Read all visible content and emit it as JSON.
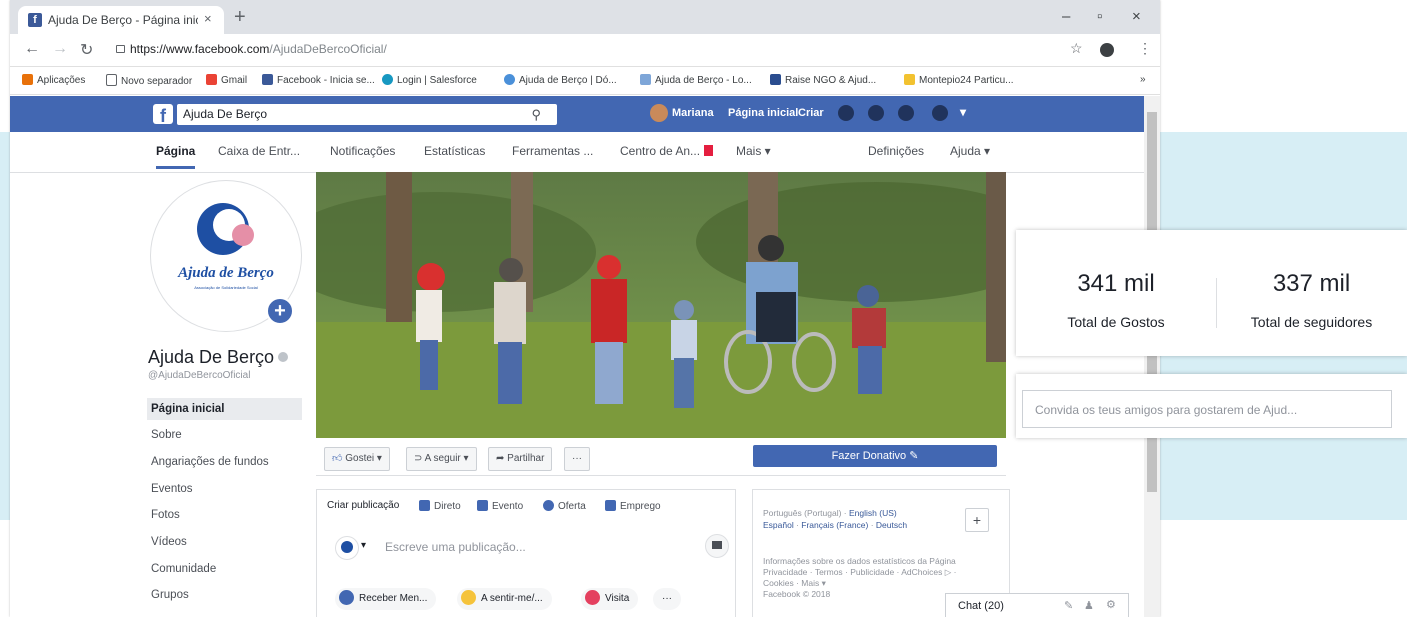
{
  "browser": {
    "tab_title": "Ajuda De Berço - Página inicial",
    "tab_close": "×",
    "new_tab": "+",
    "window_buttons": [
      "–",
      "▫",
      "×"
    ],
    "url_host": "https://www.facebook.com",
    "url_path": "/AjudaDeBercoOficial/",
    "bookmarks": [
      {
        "label": "Aplicações",
        "color": "#e8710a"
      },
      {
        "label": "Novo separador",
        "color": "#5f6368"
      },
      {
        "label": "Gmail",
        "color": "#ea4335"
      },
      {
        "label": "Facebook - Inicia se...",
        "color": "#3b5998"
      },
      {
        "label": "Login | Salesforce",
        "color": "#1798c1"
      },
      {
        "label": "Ajuda de Berço | Dó...",
        "color": "#4a90d9"
      },
      {
        "label": "Ajuda de Berço - Lo...",
        "color": "#7ea6d8"
      },
      {
        "label": "Raise NGO & Ajud...",
        "color": "#2a4d8f"
      },
      {
        "label": "Montepio24 Particu...",
        "color": "#f2c230"
      }
    ]
  },
  "fb": {
    "logo": "f",
    "search_value": "Ajuda De Berço",
    "user": "Mariana",
    "home": "Página inicial",
    "create": "Criar"
  },
  "pagenav": {
    "items": [
      "Página",
      "Caixa de Entr...",
      "Notificações",
      "Estatísticas",
      "Ferramentas ...",
      "Centro de An...",
      "Mais ▾",
      "Definições",
      "Ajuda ▾"
    ]
  },
  "page": {
    "logo_text": "Ajuda de Berço",
    "logo_sub": "Associação de Solidariedade Social",
    "name": "Ajuda De Berço",
    "handle": "@AjudaDeBercoOficial",
    "left_nav": [
      "Página inicial",
      "Sobre",
      "Angariações de fundos",
      "Eventos",
      "Fotos",
      "Vídeos",
      "Comunidade",
      "Grupos"
    ]
  },
  "actions": {
    "like": "Gostei ▾",
    "follow": "A seguir ▾",
    "share": "Partilhar",
    "more": "···",
    "donate": "Fazer Donativo ✎"
  },
  "composer": {
    "tabs": [
      {
        "label": "Criar publicação",
        "color": ""
      },
      {
        "label": "Direto",
        "color": "#4267b2"
      },
      {
        "label": "Evento",
        "color": "#4267b2"
      },
      {
        "label": "Oferta",
        "color": "#4267b2"
      },
      {
        "label": "Emprego",
        "color": "#4267b2"
      }
    ],
    "placeholder": "Escreve uma publicação...",
    "pills": [
      {
        "label": "Receber Men...",
        "color": "#4267b2"
      },
      {
        "label": "A sentir-me/...",
        "color": "#f5c33b"
      },
      {
        "label": "Visita",
        "color": "#e4405f"
      }
    ],
    "pill_more": "···"
  },
  "right": {
    "languages_line1": [
      "Português (Portugal)",
      "English (US)"
    ],
    "languages_line2": [
      "Español",
      "Français (France)",
      "Deutsch"
    ],
    "add_language": "+",
    "footer_lines": [
      "Informações sobre os dados estatísticos da Página",
      "Privacidade · Termos · Publicidade · AdChoices ▷ ·",
      "Cookies · Mais ▾",
      "Facebook © 2018"
    ],
    "chat": "Chat (20)"
  },
  "zoom": {
    "likes_value": "341 mil",
    "likes_label": "Total de Gostos",
    "followers_value": "337 mil",
    "followers_label": "Total de seguidores",
    "invite_placeholder": "Convida os teus amigos para gostarem de Ajud..."
  }
}
